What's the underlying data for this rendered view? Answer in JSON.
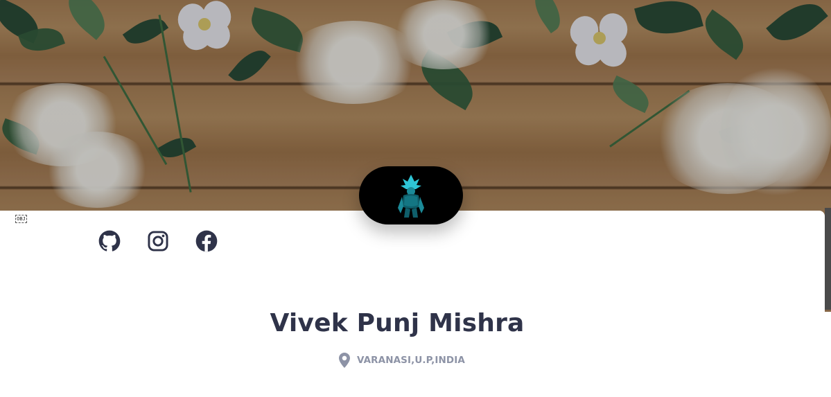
{
  "hero": {
    "background": "wooden-table-with-flowers"
  },
  "marker": {
    "text": "OBJ"
  },
  "social_links": [
    {
      "name": "github",
      "icon": "github-icon"
    },
    {
      "name": "instagram",
      "icon": "instagram-icon"
    },
    {
      "name": "facebook",
      "icon": "facebook-icon"
    }
  ],
  "profile": {
    "name": "Vivek Punj Mishra",
    "location": "VARANASI,U.P,INDIA",
    "location_icon": "map-pin-icon",
    "avatar": "avatar-character"
  },
  "colors": {
    "heading": "#2f3349",
    "muted": "#8d93a6",
    "icon": "#2f3349",
    "avatar_bg": "#000000",
    "avatar_figure": "#2ec5d6"
  }
}
